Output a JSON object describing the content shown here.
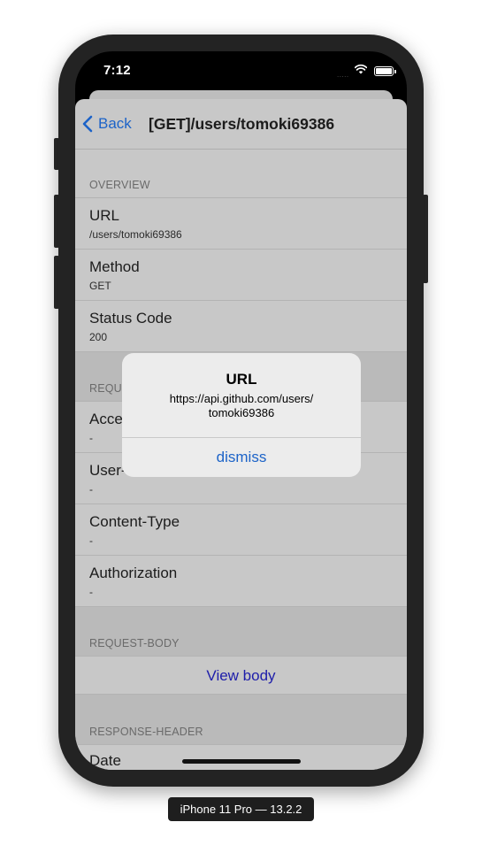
{
  "status_bar": {
    "time": "7:12",
    "signal": "....."
  },
  "navigation": {
    "back_label": "Back",
    "title": "[GET]/users/tomoki69386"
  },
  "sections": {
    "overview": {
      "header": "OVERVIEW",
      "rows": [
        {
          "title": "URL",
          "value": "/users/tomoki69386"
        },
        {
          "title": "Method",
          "value": "GET"
        },
        {
          "title": "Status Code",
          "value": "200"
        }
      ]
    },
    "request_header": {
      "header": "REQU",
      "rows": [
        {
          "title": "Acce",
          "value": "-"
        },
        {
          "title": "User-",
          "value": "-"
        },
        {
          "title": "Content-Type",
          "value": "-"
        },
        {
          "title": "Authorization",
          "value": "-"
        }
      ]
    },
    "request_body": {
      "header": "REQUEST-BODY",
      "link": "View body"
    },
    "response_header": {
      "header": "RESPONSE-HEADER",
      "rows": [
        {
          "title": "Date"
        }
      ]
    }
  },
  "alert": {
    "title": "URL",
    "message_line1": "https://api.github.com/users/",
    "message_line2": "tomoki69386",
    "button": "dismiss"
  },
  "device_label": "iPhone 11 Pro — 13.2.2",
  "colors": {
    "accent": "#1c63c8",
    "link": "#1e1eaa",
    "dimmed_background": "#c8c8c8",
    "alert_background": "#ececec"
  },
  "icons": {
    "back": "chevron-left-icon",
    "wifi": "wifi-icon",
    "battery": "battery-icon"
  }
}
